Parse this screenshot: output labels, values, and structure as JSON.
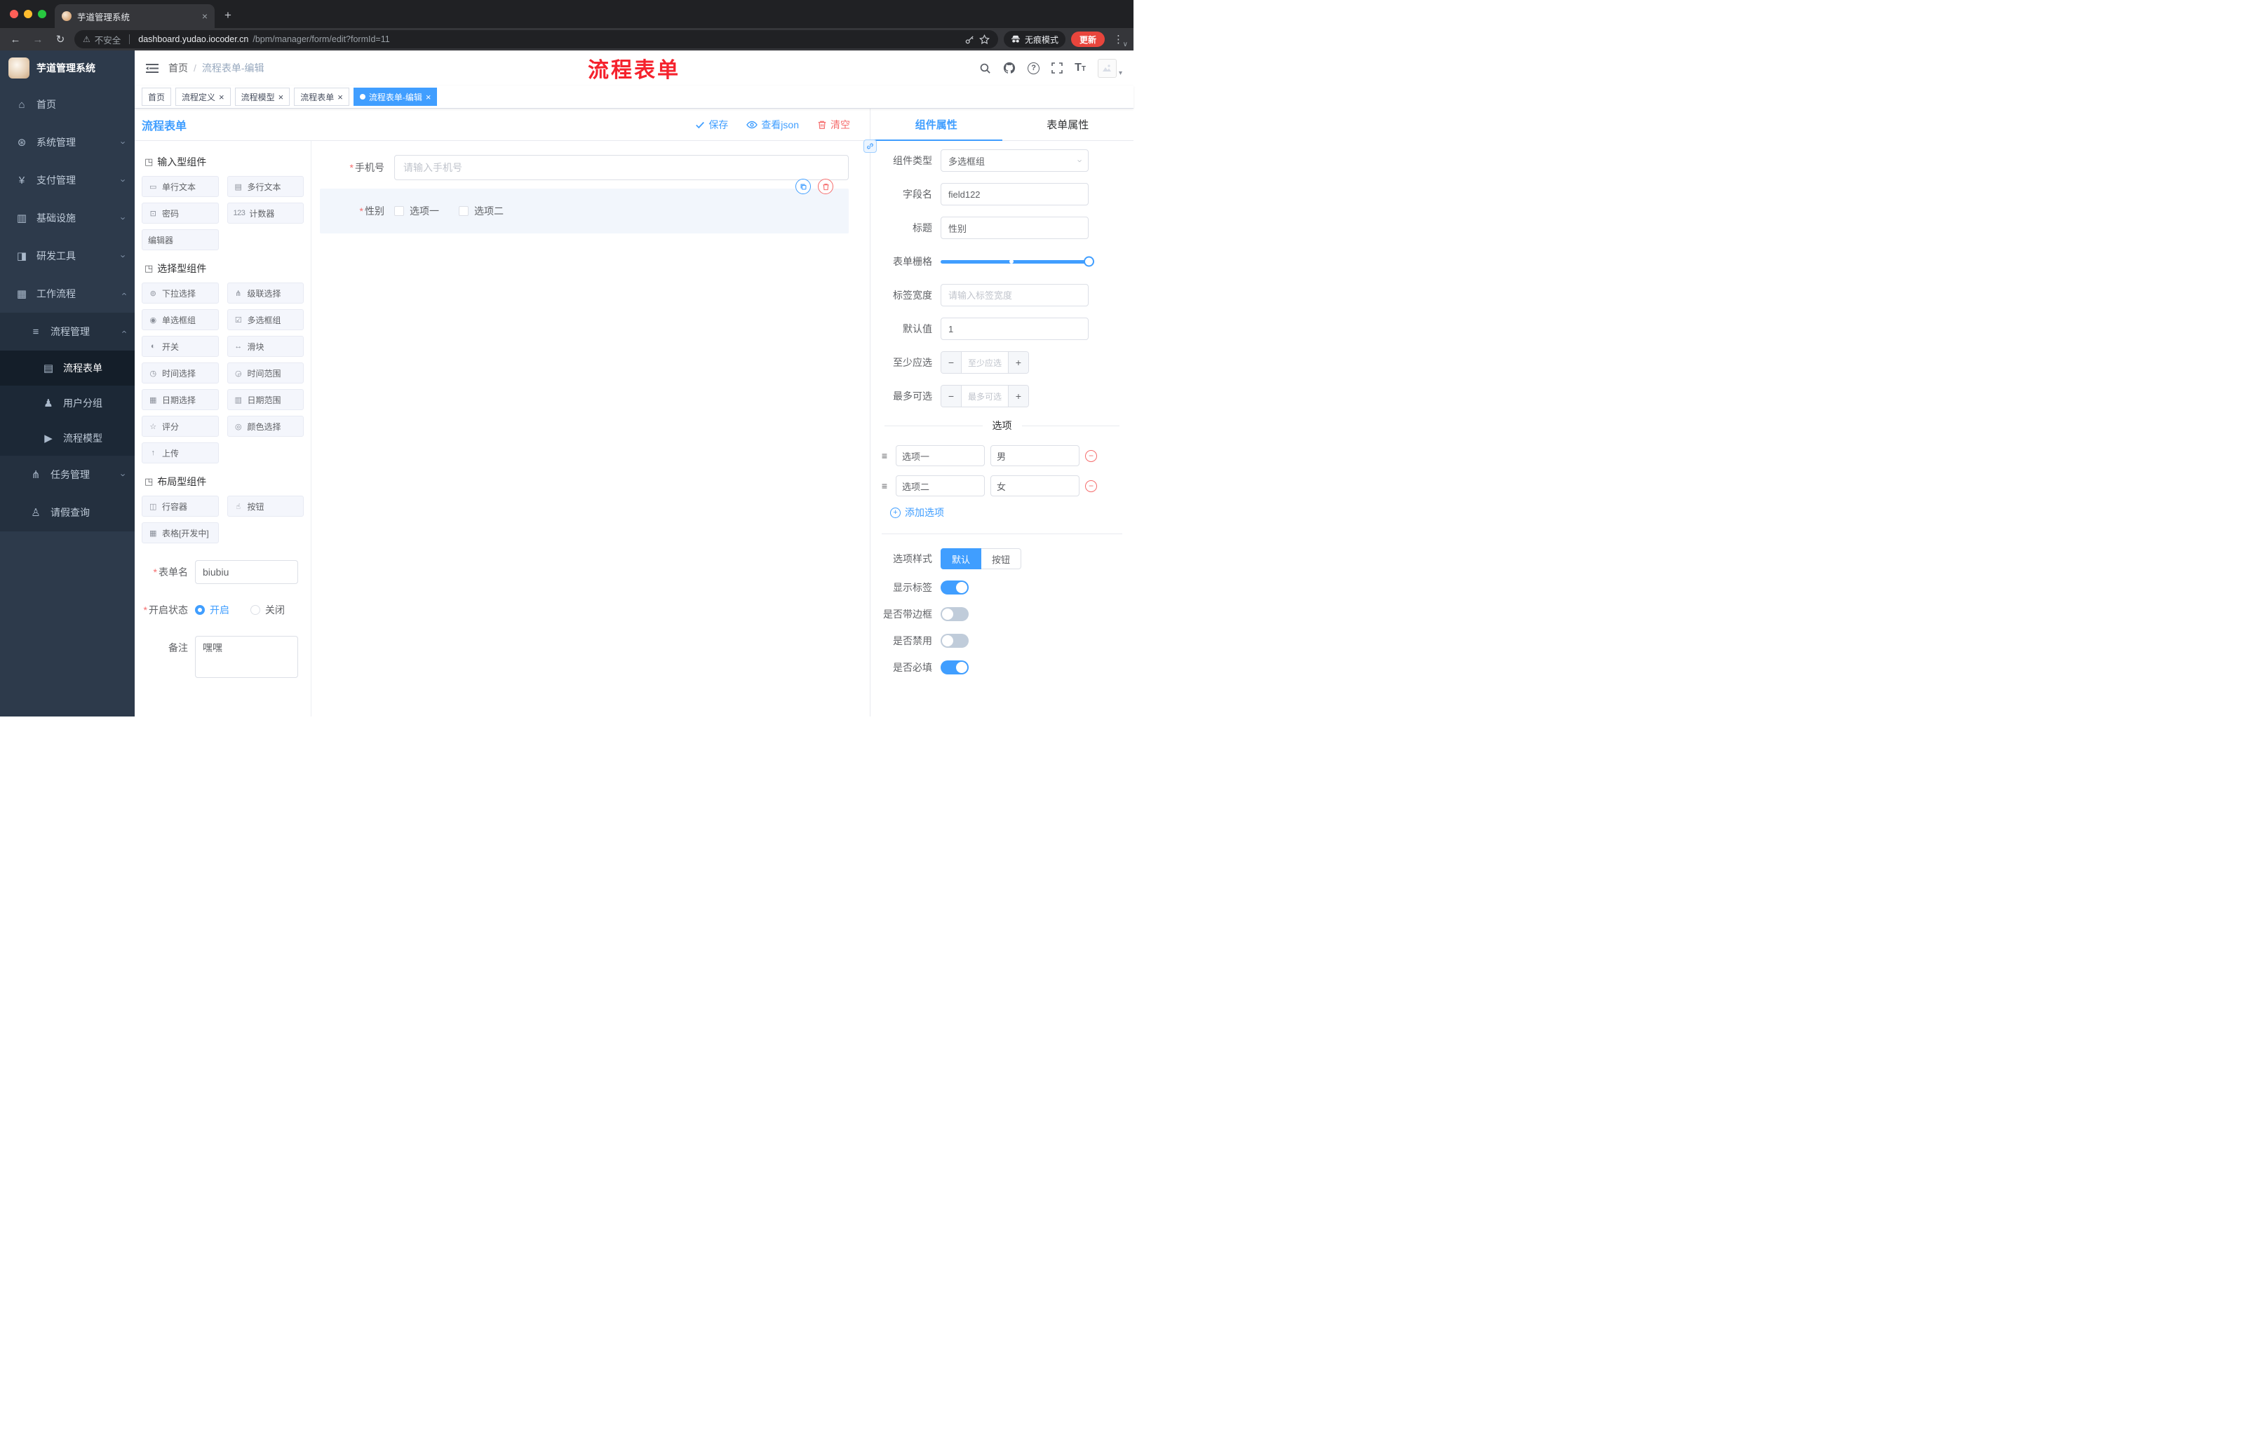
{
  "glyphs": {
    "close": "×",
    "slash": "/",
    "plus": "+",
    "minus": "−",
    "caret": "›",
    "dots": "⋮",
    "warning": "⚠",
    "question": "?",
    "font_t": "T",
    "back": "←",
    "forward": "→",
    "reload": "↻",
    "asterisk": "*",
    "chevdown": "∨",
    "avatar_caret": "▾"
  },
  "colors": {
    "primary": "#409eff",
    "danger": "#f56c6c",
    "annotation_red": "#f5222d",
    "sidebar_bg": "#2d3a4b",
    "active_tag_bg": "#409eff"
  },
  "browser": {
    "tab_title": "芋道管理系统",
    "security_label": "不安全",
    "url_host": "dashboard.yudao.iocoder.cn",
    "url_path": "/bpm/manager/form/edit?formId=11",
    "incognito_label": "无痕模式",
    "update_label": "更新"
  },
  "sidebar": {
    "logo_title": "芋道管理系统",
    "menu": [
      {
        "label": "首页",
        "icon": "⌂"
      },
      {
        "label": "系统管理",
        "icon": "⊛"
      },
      {
        "label": "支付管理",
        "icon": "¥"
      },
      {
        "label": "基础设施",
        "icon": "▥"
      },
      {
        "label": "研发工具",
        "icon": "◨"
      },
      {
        "label": "工作流程",
        "icon": "▦"
      },
      {
        "label": "流程管理",
        "icon": "≡"
      },
      {
        "label": "流程表单",
        "icon": "▤"
      },
      {
        "label": "用户分组",
        "icon": "♟"
      },
      {
        "label": "流程模型",
        "icon": "▶"
      },
      {
        "label": "任务管理",
        "icon": "⋔"
      },
      {
        "label": "请假查询",
        "icon": "♙"
      }
    ]
  },
  "header": {
    "breadcrumb_home": "首页",
    "breadcrumb_current": "流程表单-编辑",
    "annotation": "流程表单"
  },
  "tags": [
    {
      "label": "首页"
    },
    {
      "label": "流程定义"
    },
    {
      "label": "流程模型"
    },
    {
      "label": "流程表单"
    },
    {
      "label": "流程表单-编辑"
    }
  ],
  "designer": {
    "title": "流程表单",
    "actions": {
      "save": "保存",
      "view_json": "查看json",
      "clear": "清空"
    },
    "palette": {
      "groups": [
        {
          "title": "输入型组件",
          "icon": "◳",
          "items": [
            {
              "label": "单行文本",
              "icon": "▭"
            },
            {
              "label": "多行文本",
              "icon": "▤"
            },
            {
              "label": "密码",
              "icon": "⊡"
            },
            {
              "label": "计数器",
              "icon": "123"
            },
            {
              "label": "编辑器"
            }
          ]
        },
        {
          "title": "选择型组件",
          "icon": "◳",
          "items": [
            {
              "label": "下拉选择",
              "icon": "⊚"
            },
            {
              "label": "级联选择",
              "icon": "⋔"
            },
            {
              "label": "单选框组",
              "icon": "◉"
            },
            {
              "label": "多选框组",
              "icon": "☑"
            },
            {
              "label": "开关",
              "icon": "◐"
            },
            {
              "label": "滑块",
              "icon": "↔"
            },
            {
              "label": "时间选择",
              "icon": "◷"
            },
            {
              "label": "时间范围",
              "icon": "◶"
            },
            {
              "label": "日期选择",
              "icon": "▦"
            },
            {
              "label": "日期范围",
              "icon": "▥"
            },
            {
              "label": "评分",
              "icon": "☆"
            },
            {
              "label": "颜色选择",
              "icon": "◎"
            },
            {
              "label": "上传",
              "icon": "↑"
            }
          ]
        },
        {
          "title": "布局型组件",
          "icon": "◳",
          "items": [
            {
              "label": "行容器",
              "icon": "◫"
            },
            {
              "label": "按钮",
              "icon": "☝"
            },
            {
              "label": "表格[开发中]",
              "icon": "▦"
            }
          ]
        }
      ]
    },
    "meta_form": {
      "name_label": "表单名",
      "name_value": "biubiu",
      "status_label": "开启状态",
      "status_on": "开启",
      "status_off": "关闭",
      "remark_label": "备注",
      "remark_value": "嘿嘿"
    },
    "canvas": {
      "phone_label": "手机号",
      "phone_placeholder": "请输入手机号",
      "gender_label": "性别",
      "gender_option_1": "选项一",
      "gender_option_2": "选项二"
    }
  },
  "props": {
    "tab_component": "组件属性",
    "tab_form": "表单属性",
    "component_type_label": "组件类型",
    "component_type_value": "多选框组",
    "field_name_label": "字段名",
    "field_name_value": "field122",
    "title_label": "标题",
    "title_value": "性别",
    "grid_label": "表单栅格",
    "label_width_label": "标签宽度",
    "label_width_placeholder": "请输入标签宽度",
    "default_label": "默认值",
    "default_value": "1",
    "min_label": "至少应选",
    "min_placeholder": "至少应选",
    "max_label": "最多可选",
    "max_placeholder": "最多可选",
    "options_title": "选项",
    "options": [
      {
        "name": "选项一",
        "value": "男"
      },
      {
        "name": "选项二",
        "value": "女"
      }
    ],
    "add_option": "添加选项",
    "style_label": "选项样式",
    "style_default": "默认",
    "style_button": "按钮",
    "switch_show_label": "显示标签",
    "switch_border": "是否带边框",
    "switch_disabled": "是否禁用",
    "switch_required": "是否必填"
  }
}
